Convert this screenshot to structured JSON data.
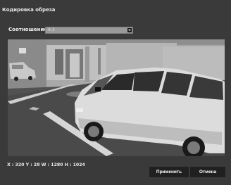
{
  "dialog": {
    "title": "Кодировка обреза"
  },
  "ratio": {
    "label": "Соотношение",
    "selected": "4:3"
  },
  "coords_text": "X : 320 Y : 28 W : 1280 H : 1024",
  "buttons": {
    "apply": "Применить",
    "cancel": "Отмена"
  }
}
